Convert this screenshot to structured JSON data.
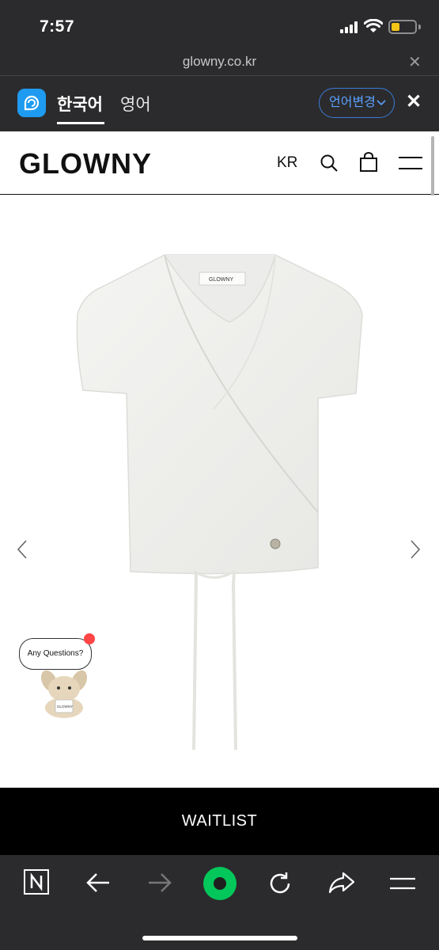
{
  "status_bar": {
    "time": "7:57",
    "battery_level": 0.35,
    "battery_color": "#f5c518"
  },
  "url_bar": {
    "url": "glowny.co.kr",
    "close_icon": "close-icon"
  },
  "translate_bar": {
    "app_icon": "papago-icon",
    "tabs": [
      {
        "label": "한국어",
        "active": true
      },
      {
        "label": "영어",
        "active": false
      }
    ],
    "change_button": "언어변경",
    "close_icon": "close-icon"
  },
  "site": {
    "logo": "GLOWNY",
    "region": "KR",
    "icons": [
      "search-icon",
      "shopping-bag-icon",
      "menu-icon"
    ],
    "gallery": {
      "image": "white wrap top product photo",
      "label_tag": "GLOWNY",
      "prev_icon": "chevron-left-icon",
      "next_icon": "chevron-right-icon"
    },
    "waitlist_button": "WAITLIST",
    "chat": {
      "bubble_text": "Any Questions?",
      "mascot_tag": "GLOWNY"
    }
  },
  "toolbar": {
    "icons": [
      "naver-home-icon",
      "back-icon",
      "forward-icon",
      "green-dot-icon",
      "reload-icon",
      "share-icon",
      "menu-icon"
    ]
  },
  "colors": {
    "accent_blue": "#1e9bf0",
    "green": "#03c75a",
    "dark": "#2b2b2d"
  }
}
